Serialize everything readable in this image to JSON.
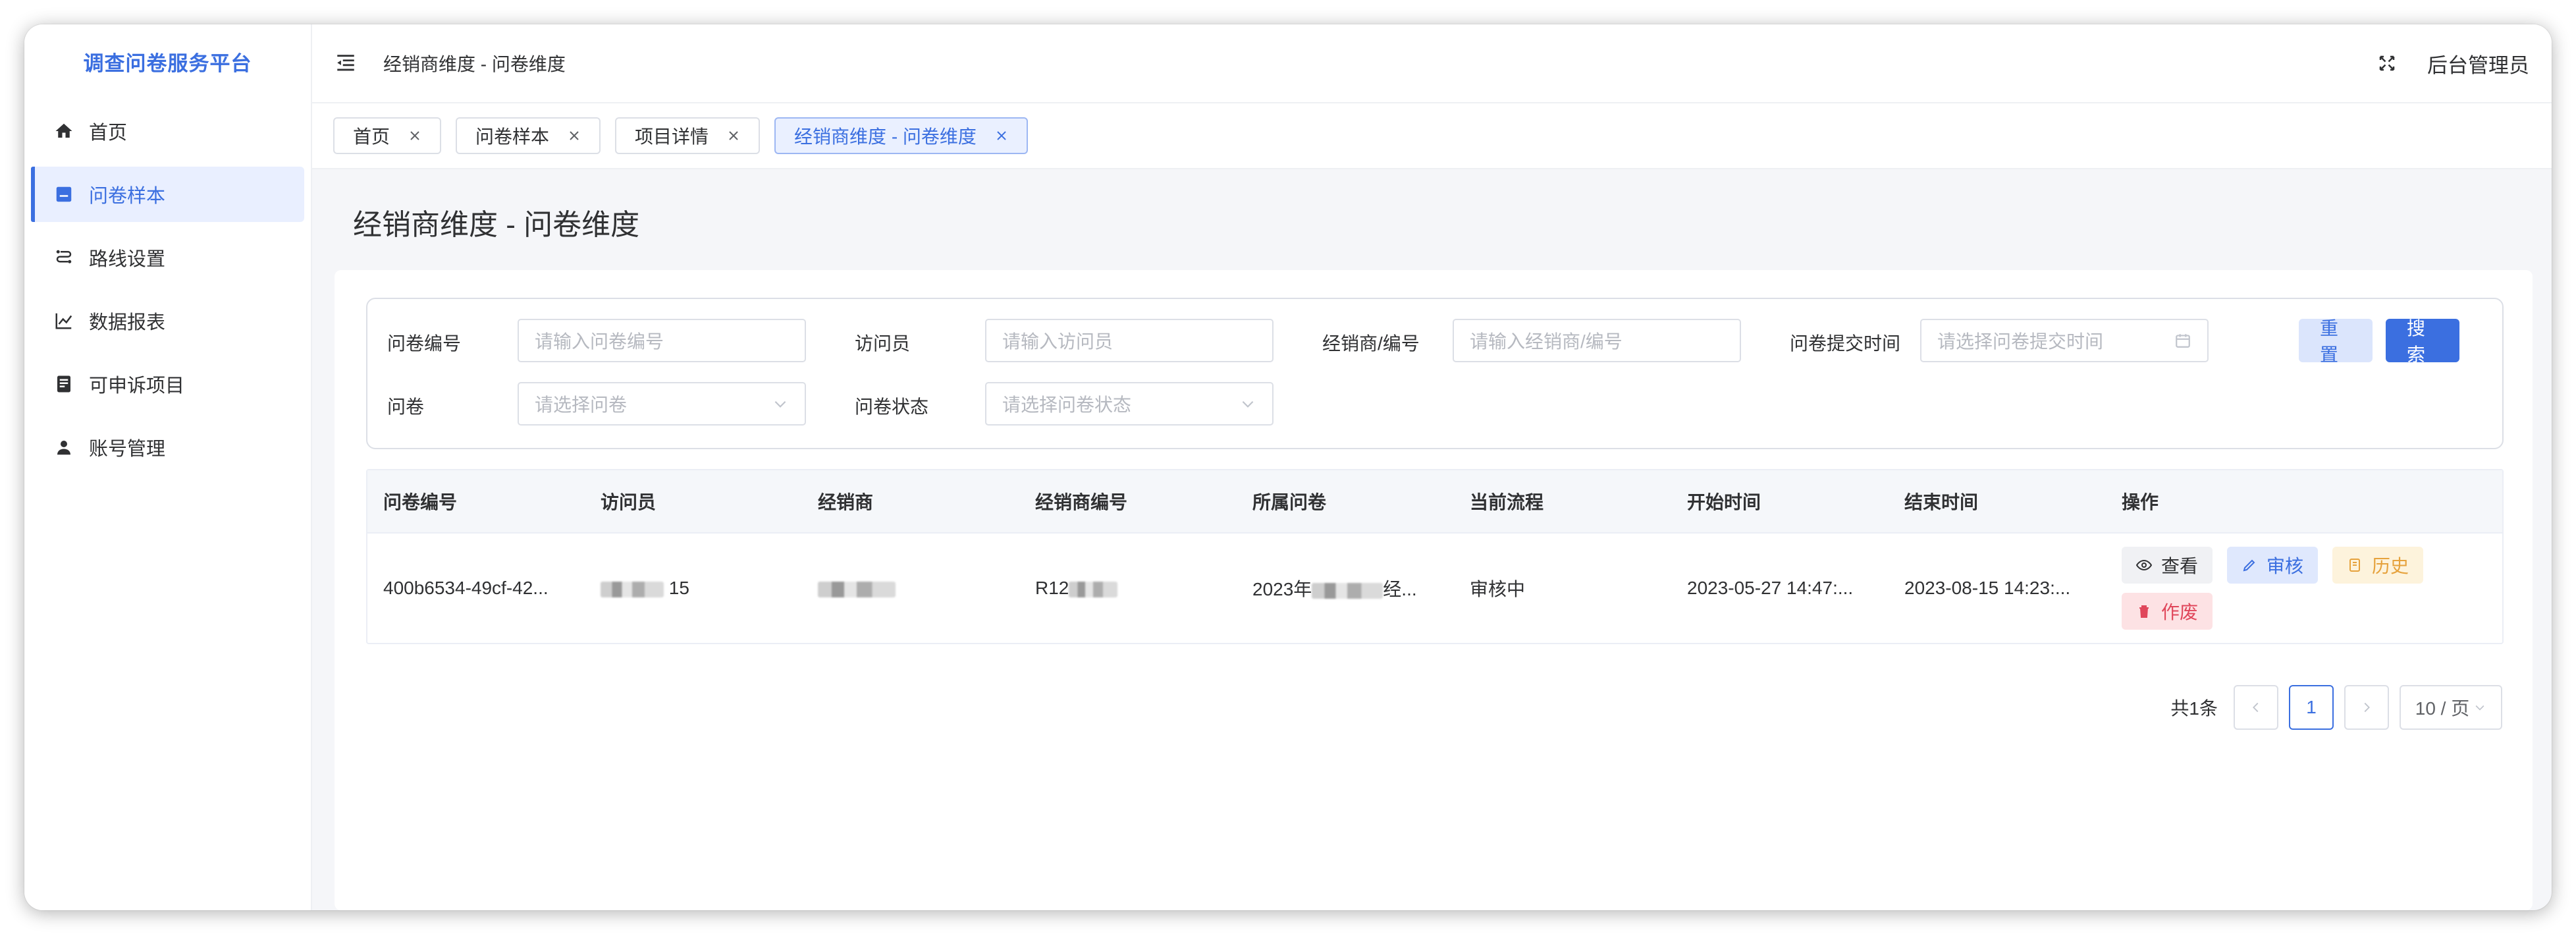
{
  "app": {
    "title": "调查问卷服务平台"
  },
  "sidebar": {
    "items": [
      {
        "label": "首页",
        "icon": "home-icon",
        "active": false
      },
      {
        "label": "问卷样本",
        "icon": "form-icon",
        "active": true
      },
      {
        "label": "路线设置",
        "icon": "route-icon",
        "active": false
      },
      {
        "label": "数据报表",
        "icon": "line-chart-icon",
        "active": false
      },
      {
        "label": "可申诉项目",
        "icon": "document-icon",
        "active": false
      },
      {
        "label": "账号管理",
        "icon": "user-icon",
        "active": false
      }
    ]
  },
  "header": {
    "breadcrumb": "经销商维度 - 问卷维度",
    "user": "后台管理员"
  },
  "tabs": [
    {
      "label": "首页",
      "active": false
    },
    {
      "label": "问卷样本",
      "active": false
    },
    {
      "label": "项目详情",
      "active": false
    },
    {
      "label": "经销商维度 - 问卷维度",
      "active": true
    }
  ],
  "page": {
    "title": "经销商维度 - 问卷维度"
  },
  "filters": {
    "questionnaire_no": {
      "label": "问卷编号",
      "placeholder": "请输入问卷编号"
    },
    "interviewer": {
      "label": "访问员",
      "placeholder": "请输入访问员"
    },
    "dealer": {
      "label": "经销商/编号",
      "placeholder": "请输入经销商/编号"
    },
    "submit_time": {
      "label": "问卷提交时间",
      "placeholder": "请选择问卷提交时间"
    },
    "questionnaire": {
      "label": "问卷",
      "placeholder": "请选择问卷"
    },
    "status": {
      "label": "问卷状态",
      "placeholder": "请选择问卷状态"
    },
    "reset_label": "重置",
    "search_label": "搜索"
  },
  "table": {
    "columns": [
      "问卷编号",
      "访问员",
      "经销商",
      "经销商编号",
      "所属问卷",
      "当前流程",
      "开始时间",
      "结束时间",
      "操作"
    ],
    "rows": [
      {
        "id": "400b6534-49cf-42...",
        "interviewer_suffix": "15",
        "dealer_code_prefix": "R12",
        "questionnaire_prefix": "2023年",
        "questionnaire_suffix": "经...",
        "flow": "审核中",
        "start": "2023-05-27 14:47:...",
        "end": "2023-08-15 14:23:..."
      }
    ],
    "actions": {
      "view": "查看",
      "audit": "审核",
      "history": "历史",
      "void": "作废"
    }
  },
  "pagination": {
    "total": "共1条",
    "current": "1",
    "page_size": "10 / 页"
  },
  "colors": {
    "primary": "#3b6fe0",
    "warning": "#e6a23c",
    "danger": "#e0475b"
  }
}
